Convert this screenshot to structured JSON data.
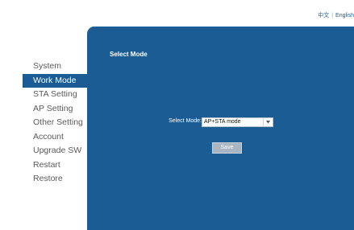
{
  "language_bar": {
    "chinese": "中文",
    "separator": "|",
    "english": "English"
  },
  "sidebar": {
    "items": [
      {
        "label": "System",
        "active": false
      },
      {
        "label": "Work Mode",
        "active": true
      },
      {
        "label": "STA Setting",
        "active": false
      },
      {
        "label": "AP Setting",
        "active": false
      },
      {
        "label": "Other Setting",
        "active": false
      },
      {
        "label": "Account",
        "active": false
      },
      {
        "label": "Upgrade SW",
        "active": false
      },
      {
        "label": "Restart",
        "active": false
      },
      {
        "label": "Restore",
        "active": false
      }
    ]
  },
  "main": {
    "title": "Select Mode",
    "select_mode_label": "Select Mode:",
    "select_mode_value": "AP+STA mode",
    "save_label": "Save"
  },
  "colors": {
    "panel": "#1a5c93",
    "active_item": "#1a5c93",
    "sidebar_text": "#5a5a5a",
    "button": "#a9b5c3"
  },
  "icons": {
    "select_arrow": "chevron-down-icon"
  }
}
